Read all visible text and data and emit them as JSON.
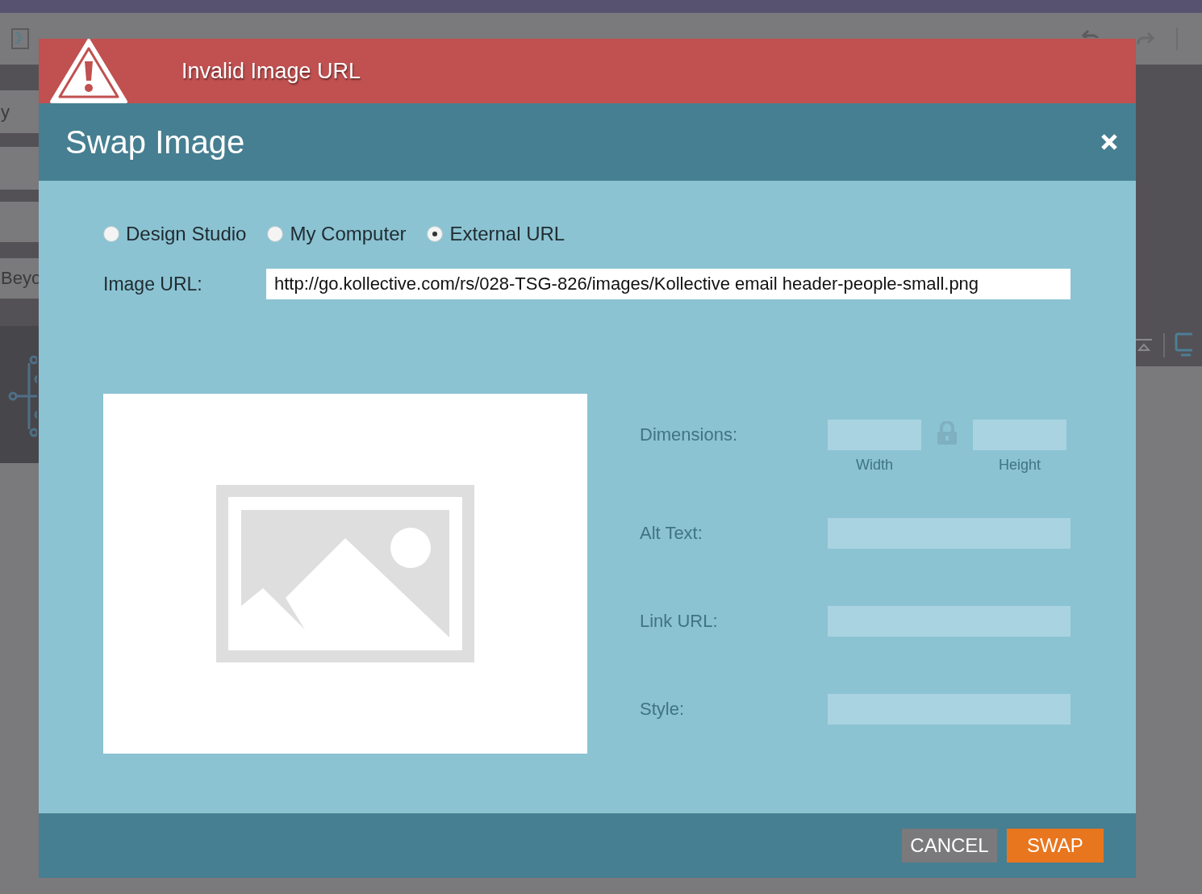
{
  "background": {
    "side_labels": [
      "y",
      "Beyo"
    ]
  },
  "dialog": {
    "alert": {
      "message": "Invalid Image URL"
    },
    "title": "Swap Image",
    "sources": [
      {
        "label": "Design Studio",
        "selected": false
      },
      {
        "label": "My Computer",
        "selected": false
      },
      {
        "label": "External URL",
        "selected": true
      }
    ],
    "image_url": {
      "label": "Image URL:",
      "value": "http://go.kollective.com/rs/028-TSG-826/images/Kollective email header-people-small.png"
    },
    "dimensions": {
      "label": "Dimensions:",
      "width_caption": "Width",
      "height_caption": "Height"
    },
    "fields": [
      {
        "label": "Alt Text:"
      },
      {
        "label": "Link URL:"
      },
      {
        "label": "Style:"
      }
    ],
    "buttons": [
      {
        "label": "CANCEL",
        "kind": "secondary"
      },
      {
        "label": "SWAP",
        "kind": "primary"
      }
    ]
  }
}
